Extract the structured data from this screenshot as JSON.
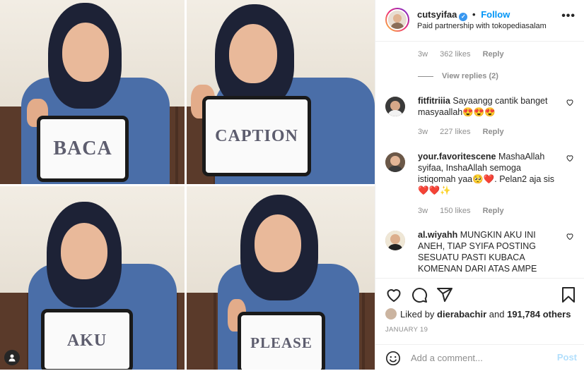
{
  "photos": [
    {
      "sign": "BACA"
    },
    {
      "sign": "CAPTION"
    },
    {
      "sign": "AKU"
    },
    {
      "sign": "PLEASE"
    }
  ],
  "header": {
    "username": "cutsyifaa",
    "verified_mark": "✓",
    "follow_prefix": "•",
    "follow_label": "Follow",
    "subtitle": "Paid partnership with tokopediasalam",
    "more_label": "•••"
  },
  "prev_comment": {
    "time": "3w",
    "likes": "362 likes",
    "reply_label": "Reply",
    "view_replies": "View replies (2)"
  },
  "comments": [
    {
      "user": "fitfitriiia",
      "text": "Sayaangg cantik banget masyaallah😍😍😍",
      "time": "3w",
      "likes": "227 likes",
      "reply_label": "Reply"
    },
    {
      "user": "your.favoritescene",
      "text": "MashaAllah syifaa, InshaAllah semoga istiqomah yaa🥺❤️. Pelan2 aja sis ❤️❤️✨",
      "time": "3w",
      "likes": "150 likes",
      "reply_label": "Reply"
    },
    {
      "user": "al.wiyahh",
      "text": "MUNGKIN AKU INI ANEH, TIAP SYIFA POSTING SESUATU PASTI KUBACA KOMENAN DARI ATAS AMPE"
    }
  ],
  "likes": {
    "prefix": "Liked by",
    "first_liker": "dierabachir",
    "and": "and",
    "others": "191,784 others"
  },
  "date": "JANUARY 19",
  "add_comment": {
    "placeholder": "Add a comment...",
    "post_label": "Post"
  },
  "colors": {
    "link_blue": "#0095f6",
    "post_disabled": "#b2dffc",
    "meta_gray": "#8e8e8e"
  },
  "icons": [
    "heart-icon",
    "comment-icon",
    "share-icon",
    "bookmark-icon",
    "emoji-icon",
    "user-tag-icon",
    "verified-badge-icon"
  ]
}
